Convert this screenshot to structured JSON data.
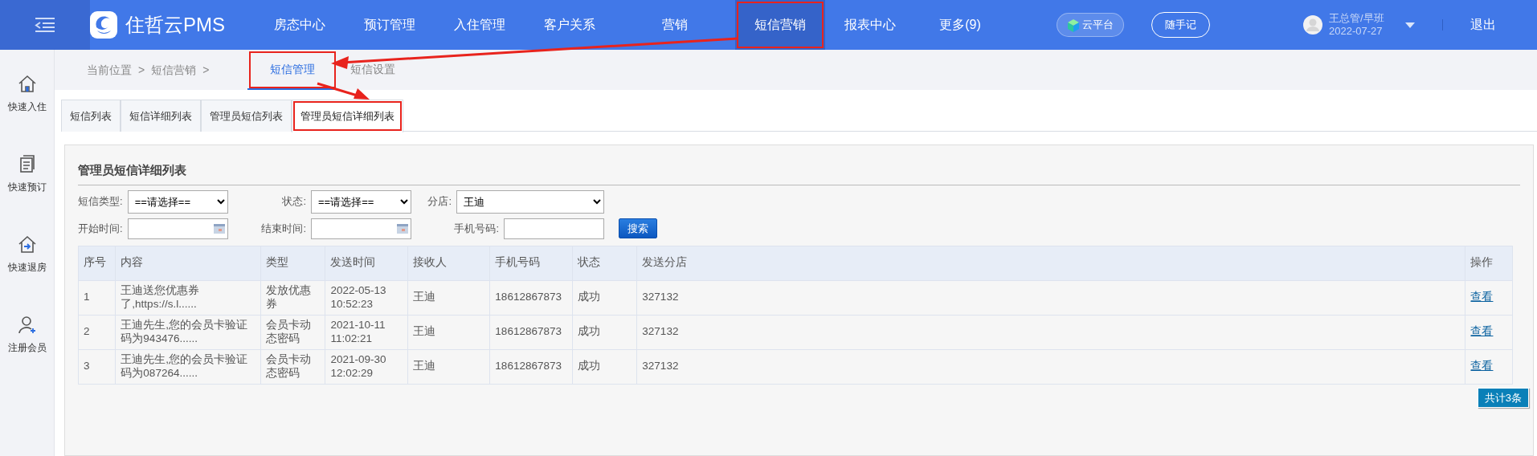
{
  "topbar": {
    "logo": "住哲云PMS",
    "nav": [
      {
        "label": "房态中心",
        "selected": false,
        "highlighted": false
      },
      {
        "label": "预订管理",
        "selected": false,
        "highlighted": false
      },
      {
        "label": "入住管理",
        "selected": false,
        "highlighted": false
      },
      {
        "label": "客户关系",
        "selected": false,
        "highlighted": false
      },
      {
        "label": "营销",
        "selected": false,
        "highlighted": false
      },
      {
        "label": "短信营销",
        "selected": true,
        "highlighted": true
      },
      {
        "label": "报表中心",
        "selected": false,
        "highlighted": false
      },
      {
        "label": "更多(9)",
        "selected": false,
        "highlighted": false
      }
    ],
    "cloud_button": "云平台",
    "note_button": "随手记",
    "user": {
      "name": "王总管/早班",
      "date": "2022-07-27"
    },
    "logout": "退出"
  },
  "sidebar": {
    "items": [
      {
        "label": "快速入住",
        "kind": "checkin"
      },
      {
        "label": "快速预订",
        "kind": "booking"
      },
      {
        "label": "快速退房",
        "kind": "checkout"
      },
      {
        "label": "注册会员",
        "kind": "member"
      }
    ]
  },
  "breadcrumb": {
    "parts": [
      "当前位置",
      ">",
      "短信营销",
      ">"
    ],
    "subtabs": [
      {
        "label": "短信管理",
        "selected": true,
        "highlighted": true
      },
      {
        "label": "短信设置",
        "selected": false,
        "highlighted": false
      }
    ]
  },
  "tabs": [
    {
      "label": "短信列表",
      "selected": false,
      "highlighted": false
    },
    {
      "label": "短信详细列表",
      "selected": false,
      "highlighted": false
    },
    {
      "label": "管理员短信列表",
      "selected": false,
      "highlighted": false
    },
    {
      "label": "管理员短信详细列表",
      "selected": true,
      "highlighted": true
    }
  ],
  "panel": {
    "title": "管理员短信详细列表",
    "filters": [
      {
        "label": "短信类型:",
        "kind": "select",
        "value": "==请选择=="
      },
      {
        "label": "状态:",
        "kind": "select",
        "value": "==请选择=="
      },
      {
        "label": "分店:",
        "kind": "select",
        "value": "王迪"
      },
      {
        "label": "开始时间:",
        "kind": "date"
      },
      {
        "label": "结束时间:",
        "kind": "date"
      },
      {
        "label": "手机号码:",
        "kind": "text"
      }
    ],
    "search_button": "搜索",
    "table": {
      "columns": [
        "序号",
        "内容",
        "类型",
        "发送时间",
        "接收人",
        "手机号码",
        "状态",
        "发送分店",
        "操作"
      ],
      "rows": [
        [
          "1",
          "王迪送您优惠券了,https://s.l......",
          "发放优惠券",
          "2022-05-13 10:52:23",
          "王迪",
          "18612867873",
          "成功",
          "327132",
          "查看"
        ],
        [
          "2",
          "王迪先生,您的会员卡验证码为943476......",
          "会员卡动态密码",
          "2021-10-11 11:02:21",
          "王迪",
          "18612867873",
          "成功",
          "327132",
          "查看"
        ],
        [
          "3",
          "王迪先生,您的会员卡验证码为087264......",
          "会员卡动态密码",
          "2021-09-30 12:02:29",
          "王迪",
          "18612867873",
          "成功",
          "327132",
          "查看"
        ]
      ]
    },
    "total": "共计3条"
  }
}
